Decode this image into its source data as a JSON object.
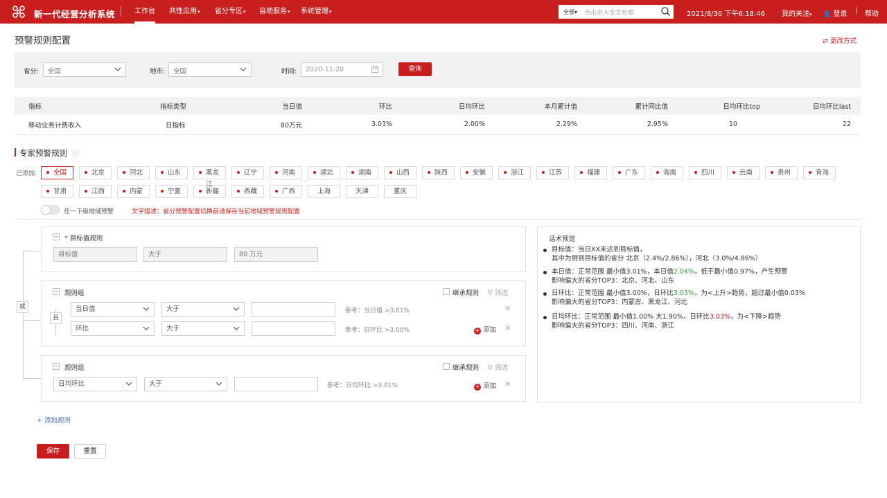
{
  "header": {
    "brand": "新一代经营分析系统",
    "nav": [
      "工作台",
      "共性应用",
      "省分专区",
      "自助服务",
      "系统管理"
    ],
    "search_scope": "全部",
    "search_placeholder": "点击进入全文检索",
    "datetime": "2021/8/30 下午6:18:46",
    "my_follow": "我的关注",
    "login": "登录",
    "help": "帮助"
  },
  "page": {
    "title": "预警规则配置",
    "change_mode": "更改方式"
  },
  "filters": {
    "province_label": "省分:",
    "province_value": "全国",
    "city_label": "地市:",
    "city_value": "全国",
    "time_label": "时间:",
    "time_value": "2020-11-20",
    "query": "查询"
  },
  "metric_table": {
    "headers": [
      "指标",
      "指标类型",
      "当日值",
      "环比",
      "日均环比",
      "本月累计值",
      "累计同比值",
      "日均环比top",
      "日均环比last"
    ],
    "rows": [
      [
        "移动业务计费收入",
        "日指标",
        "80万元",
        "3.03%",
        "2.00%",
        "2.29%",
        "2.95%",
        "10",
        "22"
      ]
    ]
  },
  "expert": {
    "title": "专家预警规则",
    "added_label": "已添加:",
    "regions": [
      "全国",
      "北京",
      "河北",
      "山东",
      "黑龙江",
      "辽宁",
      "河南",
      "湖北",
      "湖南",
      "山西",
      "陕西",
      "安徽",
      "浙江",
      "江苏",
      "福建",
      "广东",
      "海南",
      "四川",
      "云南",
      "贵州",
      "青海",
      "甘肃",
      "江西",
      "内蒙",
      "宁夏",
      "新疆",
      "西藏",
      "广西",
      "上海",
      "天津",
      "重庆"
    ],
    "toggle_label": "任一下级地域预警",
    "desc": "文字描述：省分预警配置切换前请保存当前地域预警规则配置"
  },
  "rules": {
    "or_label": "或",
    "and_label": "且",
    "target": {
      "title": "目标值规则",
      "field": "目标值",
      "op": "大于",
      "value": "80 万元"
    },
    "group1": {
      "title": "规则组",
      "inherit": "继承规则",
      "filter": "筛选",
      "rows": [
        {
          "field": "当日值",
          "op": "大于",
          "hint": "参考：当日值 >3.01%"
        },
        {
          "field": "环比",
          "op": "大于",
          "hint": "参考：日环比 >3.00%",
          "add": "添加"
        }
      ]
    },
    "group2": {
      "title": "规则组",
      "inherit": "继承规则",
      "filter": "筛选",
      "rows": [
        {
          "field": "日均环比",
          "op": "大于",
          "hint": "参考：日均环比 >3.01%",
          "add": "添加"
        }
      ]
    },
    "add_rule": "+ 添加规则"
  },
  "preview": {
    "title": "话术预览",
    "items": [
      {
        "l1": [
          "目标值：当日XX未达到目标值，"
        ],
        "l2": "其中为倒到目标值的省分 北京（2.4%/2.86%），河北（3.0%/4.86%）"
      },
      {
        "l1a": "本日值：正常范围 最小值3.01%，本日值",
        "l1b": "2.04%",
        "l1c": "，低于最小值0.97%，产生预警",
        "l2": "影响偏大的省分TOP3：北京、河北、山东"
      },
      {
        "l1a": "日环比：正常范围 最小值3.00%，日环比",
        "l1b": "3.03%",
        "l1c": "，为<上升>趋势，超过最小值0.03%",
        "l2": "影响偏大的省分TOP3：内蒙古、黑龙江、河北"
      },
      {
        "l1a": "日均环比：正常范围 最小值1.00% 大1.90%，日环比",
        "l1b": "3.03%",
        "l1c": "，为<下降>趋势",
        "l2": "影响偏大的省分TOP3：四川、河南、浙江"
      }
    ]
  },
  "actions": {
    "save": "保存",
    "reset": "重置"
  },
  "colors": {
    "brand": "#c81e1e",
    "up": "#3a9a3a",
    "down": "#c81e1e"
  }
}
